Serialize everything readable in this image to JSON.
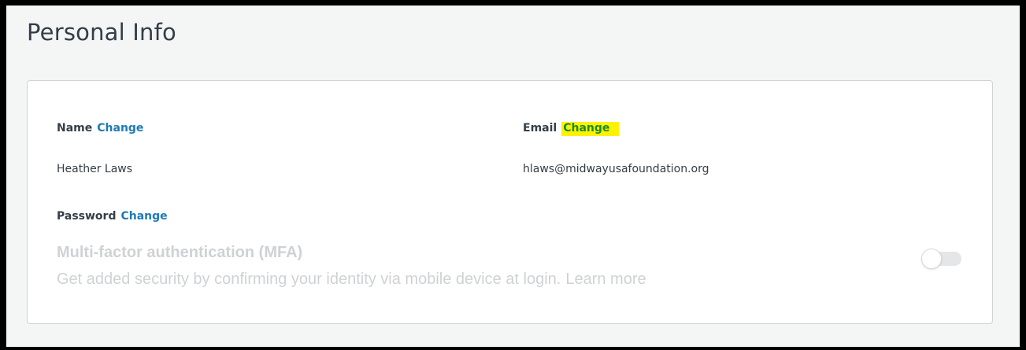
{
  "page": {
    "title": "Personal Info"
  },
  "personal_info": {
    "name": {
      "label": "Name",
      "change_label": "Change",
      "value": "Heather Laws"
    },
    "email": {
      "label": "Email",
      "change_label": "Change",
      "value": "hlaws@midwayusafoundation.org",
      "highlight_color": "#fff200"
    },
    "password": {
      "label": "Password",
      "change_label": "Change"
    },
    "mfa": {
      "title": "Multi-factor authentication (MFA)",
      "description": "Get added security by confirming your identity via mobile device at login.",
      "learn_more": "Learn more",
      "toggle_state": "off",
      "disabled": true
    }
  },
  "colors": {
    "link": "#1e7ab8",
    "text": "#333e48",
    "disabled_text": "#cfd2d4",
    "page_background": "#f4f5f5"
  }
}
